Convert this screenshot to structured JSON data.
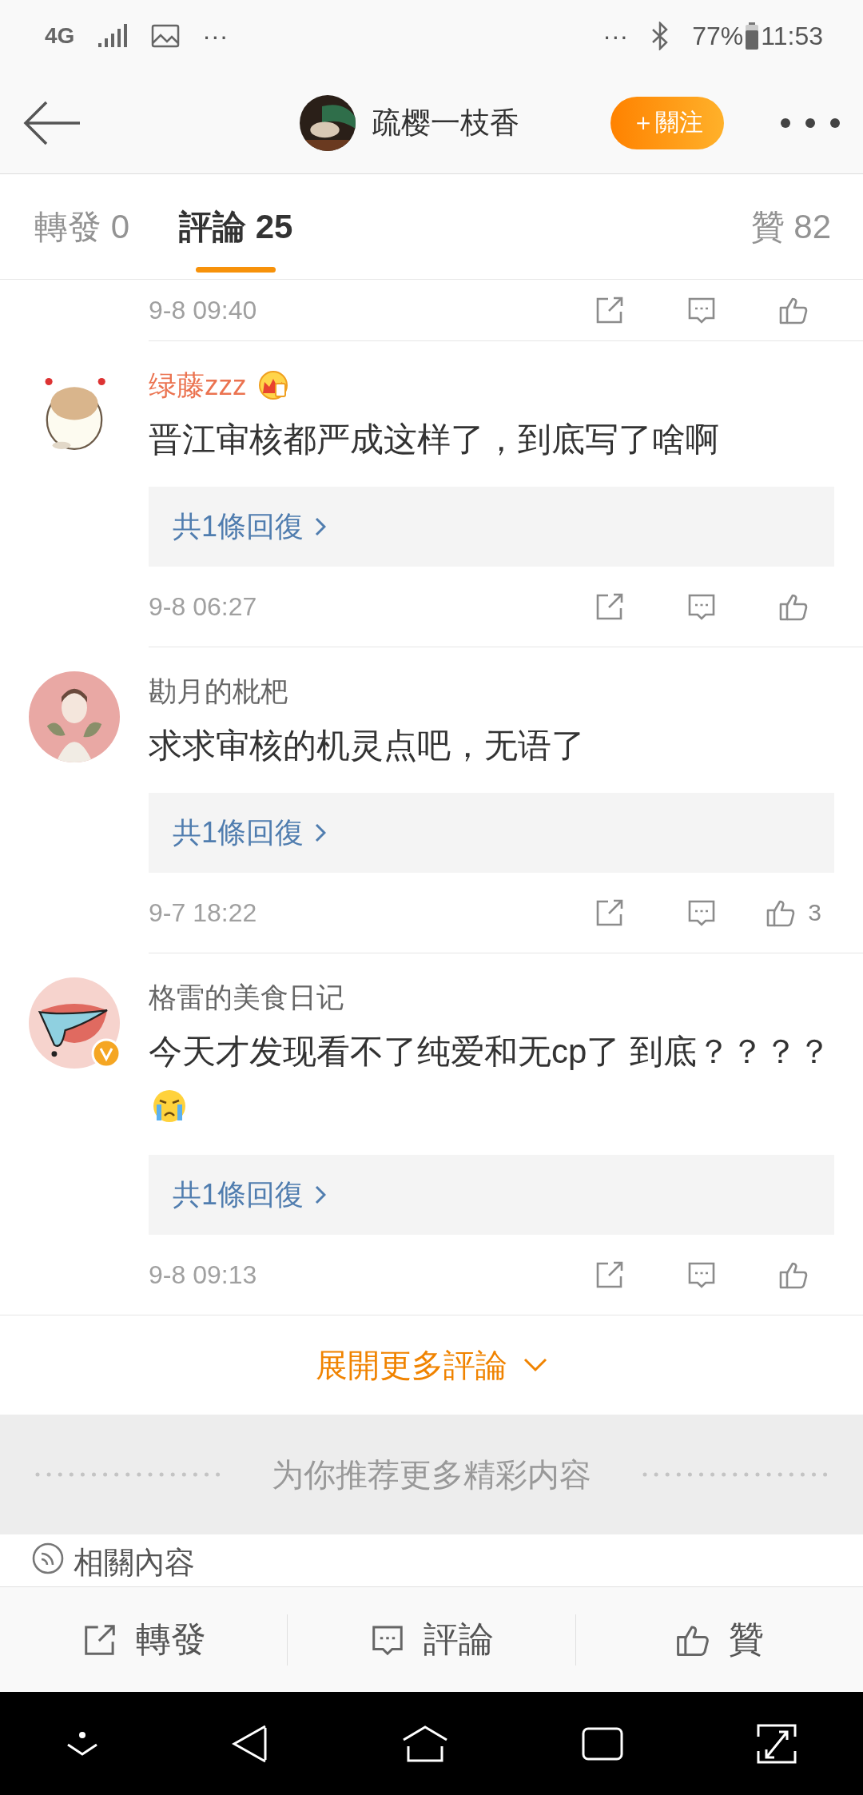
{
  "status_bar": {
    "network": "4G",
    "left_more": "···",
    "right_more": "···",
    "battery": "77%",
    "time": "11:53"
  },
  "header": {
    "user": "疏樱一枝香",
    "follow_button": "＋關注"
  },
  "tabs": [
    {
      "label": "轉發",
      "count": "0",
      "selected": false
    },
    {
      "label": "評論",
      "count": "25",
      "selected": true
    },
    {
      "label": "贊",
      "count": "82",
      "selected": false
    }
  ],
  "first_comment_footer": {
    "time": "9-8 09:40"
  },
  "comments": [
    {
      "name": "绿藤zzz",
      "vip": true,
      "verified": false,
      "text": "晋江审核都严成这样了，到底写了啥啊",
      "emoji": false,
      "replies": "共1條回復",
      "time": "9-8 06:27"
    },
    {
      "name": "勘月的枇杷",
      "vip": false,
      "verified": false,
      "text": "求求审核的机灵点吧，无语了",
      "emoji": false,
      "replies": "共1條回復",
      "time": "9-7 18:22",
      "like_count": "3"
    },
    {
      "name": "格雷的美食日记",
      "vip": false,
      "verified": true,
      "text": "今天才发现看不了纯爱和无cp了 到底？？？？",
      "emoji": true,
      "replies": "共1條回復",
      "time": "9-8 09:13"
    }
  ],
  "expand_more": "展開更多評論",
  "recommend": "为你推荐更多精彩内容",
  "related": "相關內容",
  "actions": [
    {
      "kind": "repost",
      "label": "轉發"
    },
    {
      "kind": "comment",
      "label": "評論"
    },
    {
      "kind": "like",
      "label": "贊"
    }
  ]
}
